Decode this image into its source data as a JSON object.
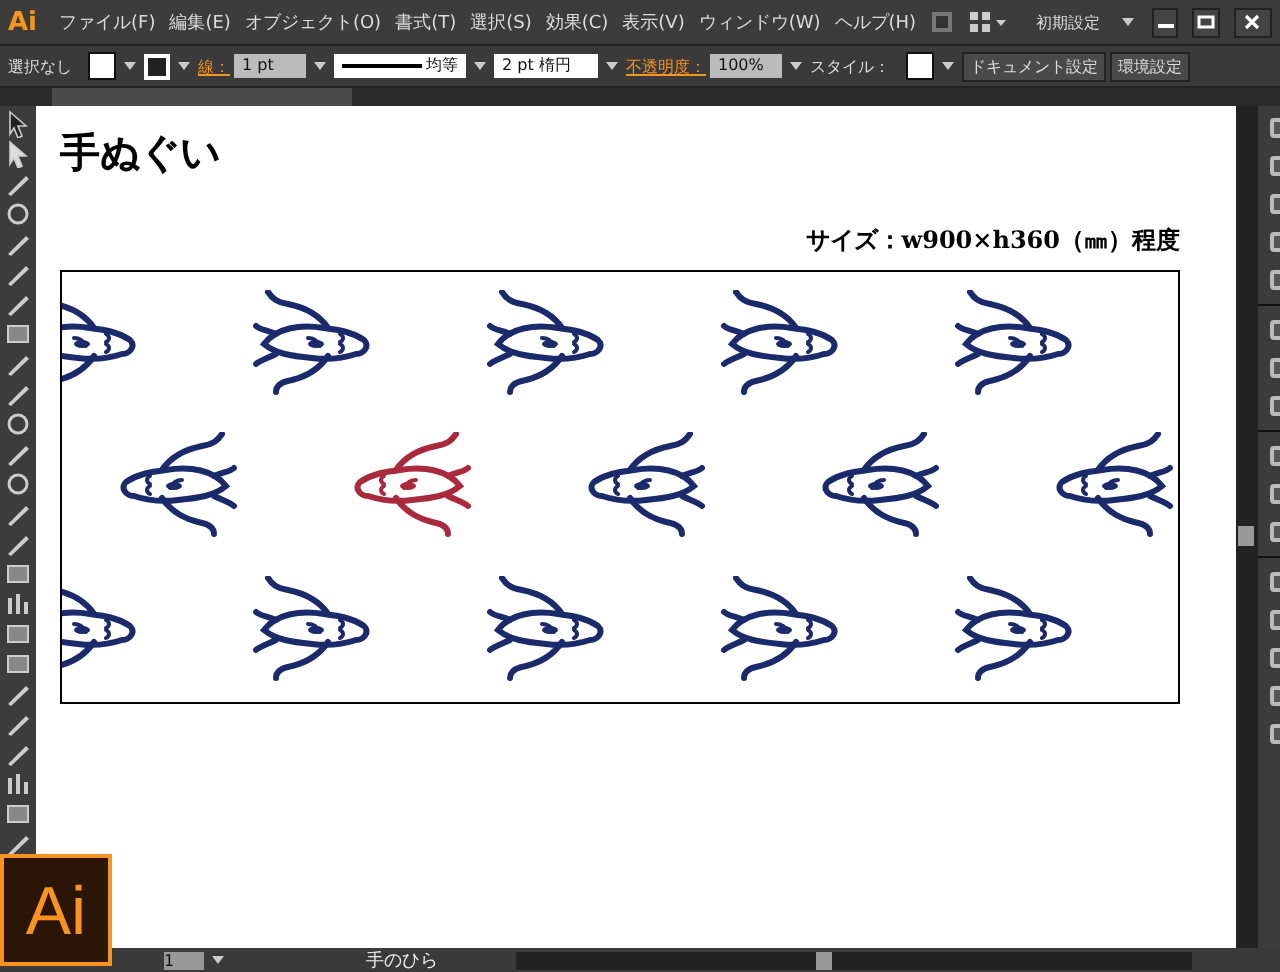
{
  "menu_bar": {
    "app_logo": "Ai",
    "items": [
      "ファイル(F)",
      "編集(E)",
      "オブジェクト(O)",
      "書式(T)",
      "選択(S)",
      "効果(C)",
      "表示(V)",
      "ウィンドウ(W)",
      "ヘルプ(H)"
    ],
    "workspace": "初期設定"
  },
  "control_bar": {
    "selection": "選択なし",
    "stroke_label": "線：",
    "stroke_weight": "1 pt",
    "stroke_profile": "均等",
    "brush": "2 pt 楕円",
    "opacity_label": "不透明度：",
    "opacity": "100%",
    "style_label": "スタイル：",
    "buttons": [
      "ドキュメント設定",
      "環境設定"
    ]
  },
  "document": {
    "title": "手ぬぐい",
    "size_note": "サイズ：w900×h360（㎜）程度",
    "pattern_rows": [
      {
        "motifs": [
          {
            "color": "#1b2a6b"
          },
          {
            "color": "#1b2a6b"
          },
          {
            "color": "#1b2a6b"
          },
          {
            "color": "#1b2a6b"
          },
          {
            "color": "#1b2a6b"
          }
        ]
      },
      {
        "motifs": [
          {
            "color": "#1b2a6b"
          },
          {
            "color": "#a82a3c"
          },
          {
            "color": "#1b2a6b"
          },
          {
            "color": "#1b2a6b"
          },
          {
            "color": "#1b2a6b"
          }
        ]
      },
      {
        "motifs": [
          {
            "color": "#1b2a6b"
          },
          {
            "color": "#1b2a6b"
          },
          {
            "color": "#1b2a6b"
          },
          {
            "color": "#1b2a6b"
          },
          {
            "color": "#1b2a6b"
          }
        ]
      }
    ]
  },
  "status_bar": {
    "artboard": "1",
    "tool": "手のひら"
  },
  "badge": "Ai"
}
